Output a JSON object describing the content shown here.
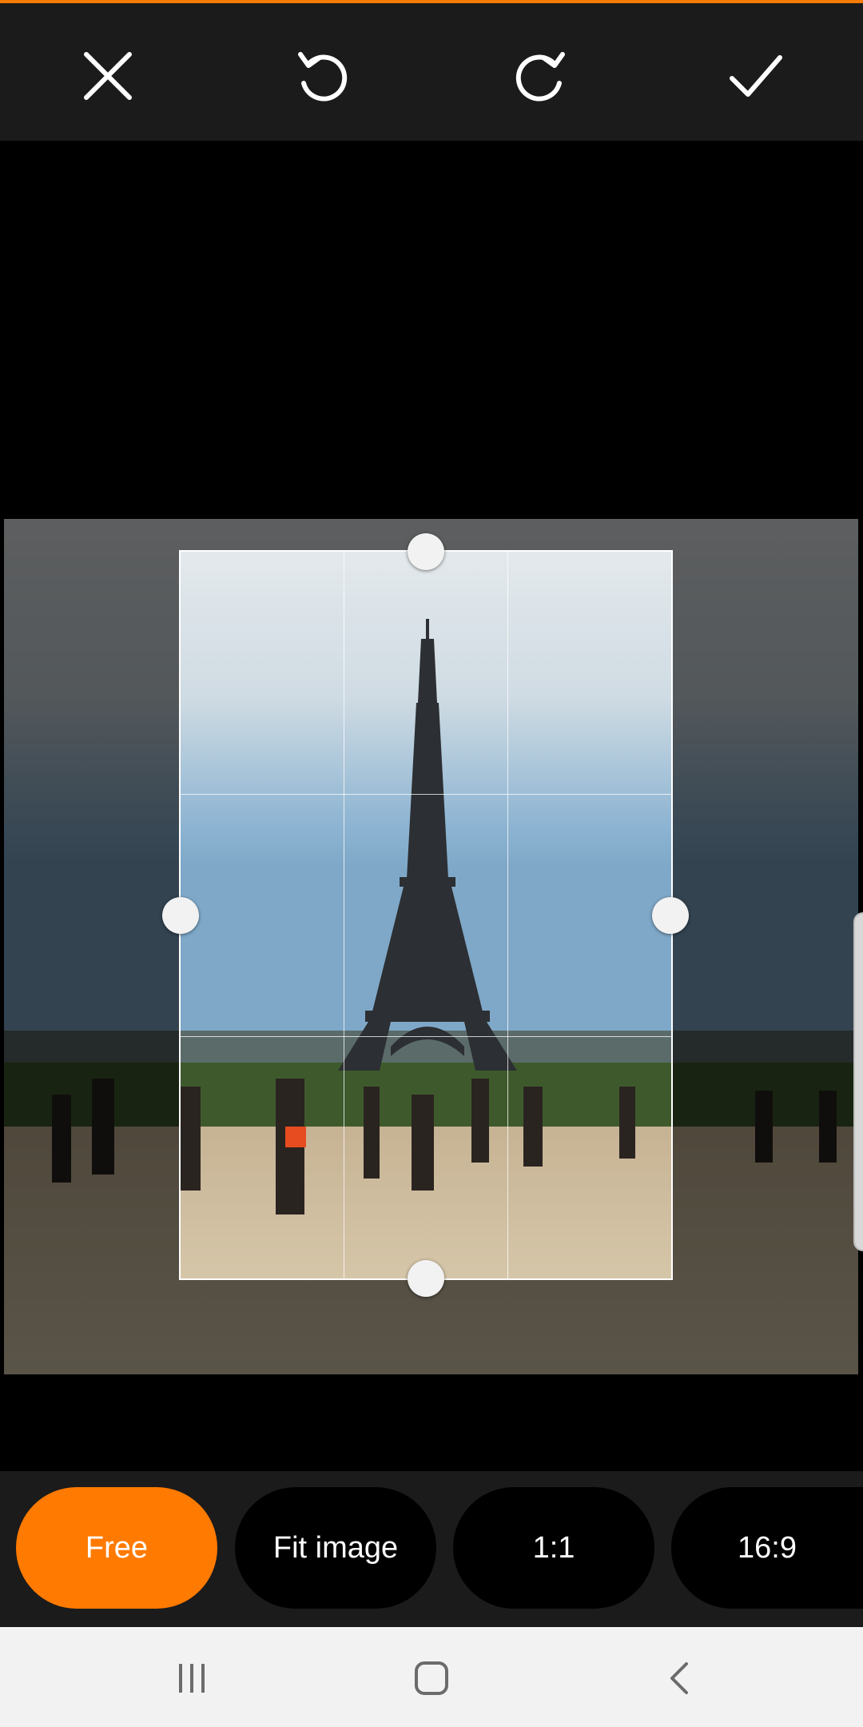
{
  "toolbar": {
    "close_icon": "close-icon",
    "rotate_left_icon": "rotate-left-icon",
    "rotate_right_icon": "rotate-right-icon",
    "confirm_icon": "check-icon"
  },
  "ratio_options": [
    {
      "label": "Free",
      "active": true
    },
    {
      "label": "Fit image",
      "active": false
    },
    {
      "label": "1:1",
      "active": false
    },
    {
      "label": "16:9",
      "active": false
    }
  ],
  "colors": {
    "accent": "#ff7a00",
    "toolbar_bg": "#1b1b1b",
    "nav_bg": "#f2f2f2"
  },
  "navigation": {
    "recents_icon": "recent-apps-icon",
    "home_icon": "home-icon",
    "back_icon": "back-icon"
  }
}
